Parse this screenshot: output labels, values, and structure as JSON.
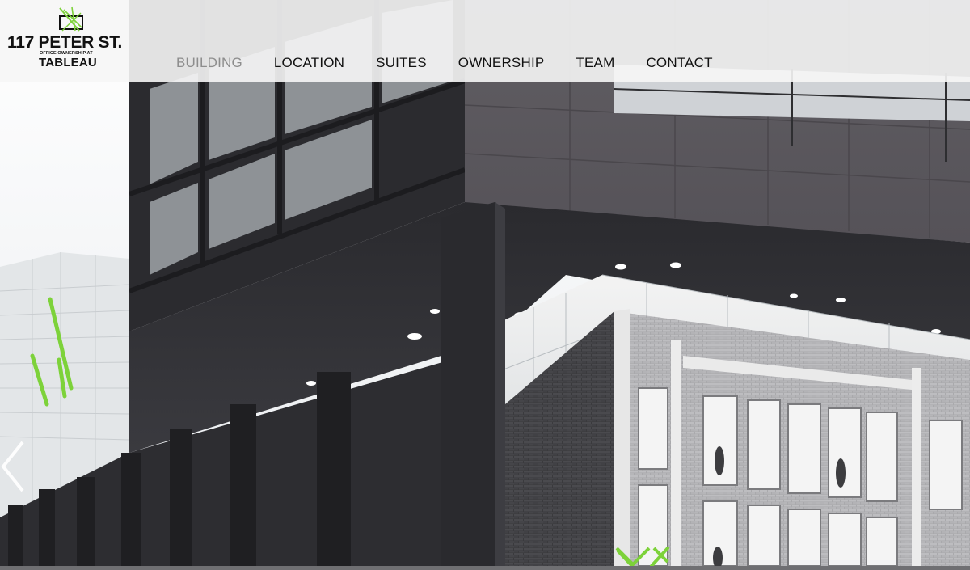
{
  "site": {
    "logo_title": "117 PETER ST.",
    "logo_subtitle": "OFFICE OWNERSHIP AT",
    "logo_brand": "TABLEAU"
  },
  "nav": {
    "items": [
      {
        "label": "BUILDING",
        "active": true
      },
      {
        "label": "LOCATION",
        "active": false
      },
      {
        "label": "SUITES",
        "active": false
      },
      {
        "label": "OWNERSHIP",
        "active": false
      },
      {
        "label": "TEAM",
        "active": false
      },
      {
        "label": "CONTACT",
        "active": false
      }
    ]
  },
  "slider": {
    "prev_icon": "chevron-left-icon",
    "next_icon": "chevron-down-icon"
  },
  "colors": {
    "accent_green": "#7dd23a",
    "nav_active": "#8d8d8d",
    "nav_text": "#111111",
    "header_bg": "#f6f6f6"
  }
}
